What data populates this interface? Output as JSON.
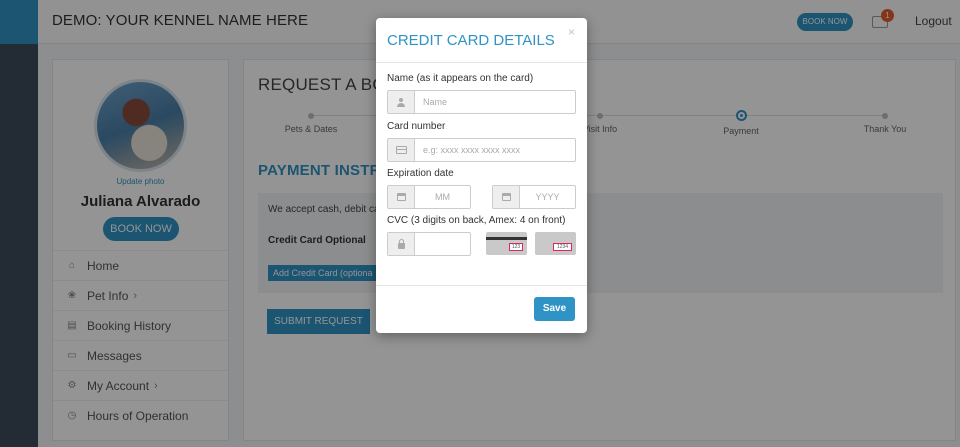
{
  "header": {
    "title": "DEMO: YOUR KENNEL NAME HERE",
    "book_now": "BOOK NOW",
    "notification_count": "1",
    "logout": "Logout"
  },
  "profile": {
    "update_photo": "Update photo",
    "name": "Juliana Alvarado",
    "book_now": "BOOK NOW"
  },
  "sidebar": {
    "items": [
      {
        "label": "Home",
        "icon": "home-icon"
      },
      {
        "label": "Pet Info",
        "icon": "paw-icon"
      },
      {
        "label": "Booking History",
        "icon": "book-icon"
      },
      {
        "label": "Messages",
        "icon": "inbox-icon"
      },
      {
        "label": "My Account",
        "icon": "gear-icon"
      },
      {
        "label": "Hours of Operation",
        "icon": "clock-icon"
      }
    ]
  },
  "main": {
    "title": "REQUEST A BOA",
    "steps": [
      "Pets & Dates",
      "Visit Info",
      "Payment",
      "Thank You"
    ],
    "active_step": "Payment",
    "payment_heading": "PAYMENT INSTRU",
    "payment_text": "We accept cash, debit ca",
    "cc_optional": "Credit Card Optional",
    "add_cc": "Add Credit Card (optiona",
    "submit": "SUBMIT REQUEST"
  },
  "modal": {
    "title": "CREDIT CARD DETAILS",
    "close": "×",
    "name_label": "Name (as it appears on the card)",
    "name_placeholder": "Name",
    "number_label": "Card number",
    "number_placeholder": "e.g: xxxx xxxx xxxx xxxx",
    "exp_label": "Expiration date",
    "month_placeholder": "MM",
    "year_placeholder": "YYYY",
    "cvc_label": "CVC (3 digits on back, Amex: 4 on front)",
    "cvc_sample_3": "123",
    "cvc_sample_4": "1234",
    "save": "Save"
  },
  "colors": {
    "accent": "#2f93c5",
    "badge": "#e65c2e",
    "rail": "#3d4b5a"
  }
}
